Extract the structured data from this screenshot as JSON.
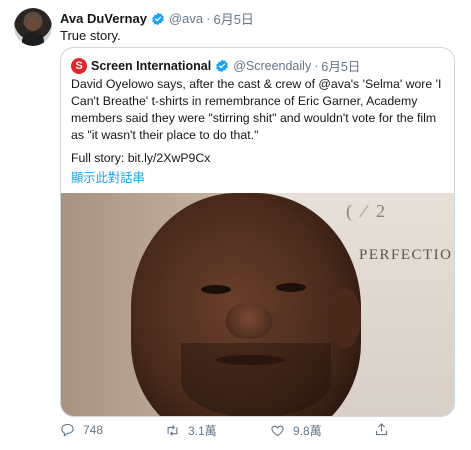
{
  "tweet": {
    "author_name": "Ava DuVernay",
    "handle": "@ava",
    "date": "6月5日",
    "text": "True story.",
    "separator": "·"
  },
  "quoted": {
    "logo_letter": "S",
    "author_name": "Screen International",
    "handle": "@Screendaily",
    "date": "6月5日",
    "text": "David Oyelowo says, after the cast & crew of @ava's 'Selma' wore 'I Can't Breathe' t-shirts in remembrance of Eric Garner, Academy members said they were \"stirring shit\" and wouldn't vote for the film as \"it wasn't their place to do that.\"",
    "link_line": "Full story: bit.ly/2XwP9Cx",
    "thread_link": "顯示此對話串",
    "photo_text": "PERFECTIO"
  },
  "actions": {
    "reply_count": "748",
    "retweet_count": "3.1萬",
    "like_count": "9.8萬"
  },
  "colors": {
    "accent": "#1da1f2",
    "verified": "#1da1f2",
    "logo_red": "#e0252b",
    "muted": "#657786"
  }
}
